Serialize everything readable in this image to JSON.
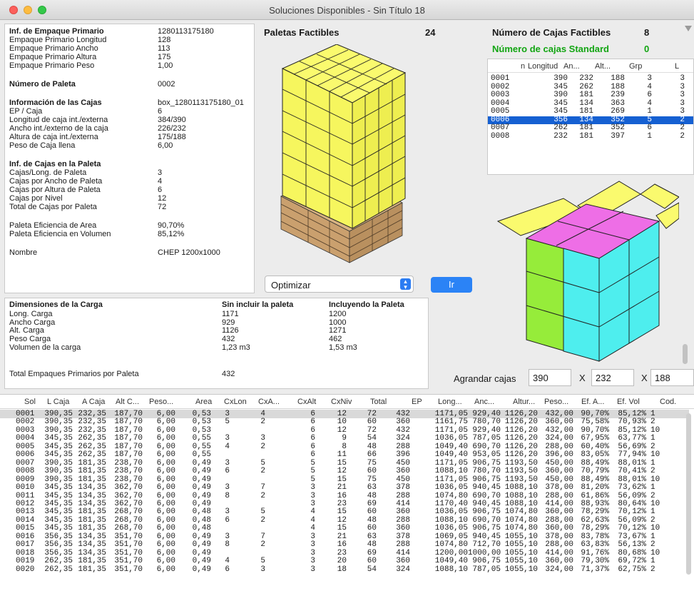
{
  "window": {
    "title": "Soluciones Disponibles - Sin Título 18"
  },
  "primary": {
    "rows": [
      {
        "label": "Inf. de Empaque Primario",
        "value": "1280113175180",
        "bold": true
      },
      {
        "label": "Empaque Primario Longitud",
        "value": "128"
      },
      {
        "label": "Empaque Primario Ancho",
        "value": "113"
      },
      {
        "label": "Empaque Primario Altura",
        "value": "175"
      },
      {
        "label": "Empaque Primario Peso",
        "value": "1,00"
      },
      {
        "label": "Número de Paleta",
        "value": "0002",
        "bold": true
      },
      {
        "label": "Información de las Cajas",
        "value": "box_1280113175180_01",
        "bold": true
      },
      {
        "label": "EP / Caja",
        "value": "6"
      },
      {
        "label": "Longitud de caja int./externa",
        "value": "384/390"
      },
      {
        "label": "Ancho int./externo de la caja",
        "value": "226/232"
      },
      {
        "label": "Altura de caja int./externa",
        "value": "175/188"
      },
      {
        "label": "Peso de Caja llena",
        "value": "6,00"
      },
      {
        "label": "Inf. de Cajas en la Paleta",
        "value": "",
        "bold": true
      },
      {
        "label": "Cajas/Long. de Paleta",
        "value": "3"
      },
      {
        "label": "Cajas por Ancho de Paleta",
        "value": "4"
      },
      {
        "label": "Cajas por Altura de Paleta",
        "value": "6"
      },
      {
        "label": "Cajas por Nivel",
        "value": "12"
      },
      {
        "label": "Total de Cajas por Paleta",
        "value": "72"
      },
      {
        "label": "Paleta Eficiencia de Area",
        "value": "90,70%"
      },
      {
        "label": "Paleta Eficiencia en Volumen",
        "value": "85,12%"
      },
      {
        "label": "Nombre",
        "value": "CHEP 1200x1000"
      }
    ]
  },
  "feasible": {
    "pallets_label": "Paletas Factibles",
    "pallets_count": "24",
    "boxes_label": "Número de Cajas Factibles",
    "boxes_count": "8",
    "standard_label": "Número de cajas Standard",
    "standard_count": "0"
  },
  "mini_table": {
    "headers": [
      "n",
      "Longitud",
      "An...",
      "Alt...",
      "Grp",
      "L"
    ],
    "rows": [
      [
        "0001",
        "390",
        "232",
        "188",
        "3",
        "3"
      ],
      [
        "0002",
        "345",
        "262",
        "188",
        "4",
        "3"
      ],
      [
        "0003",
        "390",
        "181",
        "239",
        "6",
        "3"
      ],
      [
        "0004",
        "345",
        "134",
        "363",
        "4",
        "3"
      ],
      [
        "0005",
        "345",
        "181",
        "269",
        "1",
        "3"
      ],
      [
        "0006",
        "356",
        "134",
        "352",
        "5",
        "2"
      ],
      [
        "0007",
        "262",
        "181",
        "352",
        "6",
        "2"
      ],
      [
        "0008",
        "232",
        "181",
        "397",
        "1",
        "2"
      ]
    ],
    "selected_index": 5
  },
  "controls": {
    "optimize_value": "Optimizar",
    "go_label": "Ir",
    "enlarge_label": "Agrandar cajas",
    "enlarge_x": "390",
    "enlarge_y": "232",
    "enlarge_z": "188",
    "times": "X"
  },
  "load": {
    "header": "Dimensiones de la Carga",
    "col1": "Sin incluir la paleta",
    "col2": "Incluyendo la Paleta",
    "rows": [
      {
        "label": "Long. Carga",
        "v1": "1171",
        "v2": "1200"
      },
      {
        "label": "Ancho Carga",
        "v1": "929",
        "v2": "1000"
      },
      {
        "label": "Alt. Carga",
        "v1": "1126",
        "v2": "1271"
      },
      {
        "label": "Peso Carga",
        "v1": "432",
        "v2": "462"
      },
      {
        "label": "Volumen de la carga",
        "v1": "1,23 m3",
        "v2": "1,53 m3"
      }
    ],
    "total_label": "Total Empaques Primarios por Paleta",
    "total_value": "432"
  },
  "colors": {
    "box_yellow": "#fafa6e",
    "box_cyan": "#4eeeee",
    "box_green": "#96ec3a",
    "box_magenta": "#ee6ee6",
    "pallet": "#d9b382",
    "selection": "#1560d2"
  },
  "solutions": {
    "headers": [
      "Sol",
      "L Caja",
      "A Caja",
      "Alt C...",
      "Peso...",
      "Area",
      "CxLon",
      "CxA...",
      "CxAlt",
      "CxNiv",
      "Total",
      "EP",
      "Long...",
      "Anc...",
      "Altur...",
      "Peso...",
      "Ef. A...",
      "Ef. Vol",
      "Cod."
    ],
    "rows": [
      [
        "0001",
        "390,35",
        "232,35",
        "187,70",
        "6,00",
        "0,53",
        "3",
        "4",
        "6",
        "12",
        "72",
        "432",
        "1171,05",
        "929,40",
        "1126,20",
        "432,00",
        "90,70%",
        "85,12%",
        "1"
      ],
      [
        "0002",
        "390,35",
        "232,35",
        "187,70",
        "6,00",
        "0,53",
        "5",
        "2",
        "6",
        "10",
        "60",
        "360",
        "1161,75",
        "780,70",
        "1126,20",
        "360,00",
        "75,58%",
        "70,93%",
        "2"
      ],
      [
        "0003",
        "390,35",
        "232,35",
        "187,70",
        "6,00",
        "0,53",
        "",
        "",
        "6",
        "12",
        "72",
        "432",
        "1171,05",
        "929,40",
        "1126,20",
        "432,00",
        "90,70%",
        "85,12%",
        "10"
      ],
      [
        "0004",
        "345,35",
        "262,35",
        "187,70",
        "6,00",
        "0,55",
        "3",
        "3",
        "6",
        "9",
        "54",
        "324",
        "1036,05",
        "787,05",
        "1126,20",
        "324,00",
        "67,95%",
        "63,77%",
        "1"
      ],
      [
        "0005",
        "345,35",
        "262,35",
        "187,70",
        "6,00",
        "0,55",
        "4",
        "2",
        "6",
        "8",
        "48",
        "288",
        "1049,40",
        "690,70",
        "1126,20",
        "288,00",
        "60,40%",
        "56,69%",
        "2"
      ],
      [
        "0006",
        "345,35",
        "262,35",
        "187,70",
        "6,00",
        "0,55",
        "",
        "",
        "6",
        "11",
        "66",
        "396",
        "1049,40",
        "953,05",
        "1126,20",
        "396,00",
        "83,05%",
        "77,94%",
        "10"
      ],
      [
        "0007",
        "390,35",
        "181,35",
        "238,70",
        "6,00",
        "0,49",
        "3",
        "5",
        "5",
        "15",
        "75",
        "450",
        "1171,05",
        "906,75",
        "1193,50",
        "450,00",
        "88,49%",
        "88,01%",
        "1"
      ],
      [
        "0008",
        "390,35",
        "181,35",
        "238,70",
        "6,00",
        "0,49",
        "6",
        "2",
        "5",
        "12",
        "60",
        "360",
        "1088,10",
        "780,70",
        "1193,50",
        "360,00",
        "70,79%",
        "70,41%",
        "2"
      ],
      [
        "0009",
        "390,35",
        "181,35",
        "238,70",
        "6,00",
        "0,49",
        "",
        "",
        "5",
        "15",
        "75",
        "450",
        "1171,05",
        "906,75",
        "1193,50",
        "450,00",
        "88,49%",
        "88,01%",
        "10"
      ],
      [
        "0010",
        "345,35",
        "134,35",
        "362,70",
        "6,00",
        "0,49",
        "3",
        "7",
        "3",
        "21",
        "63",
        "378",
        "1036,05",
        "940,45",
        "1088,10",
        "378,00",
        "81,20%",
        "73,62%",
        "1"
      ],
      [
        "0011",
        "345,35",
        "134,35",
        "362,70",
        "6,00",
        "0,49",
        "8",
        "2",
        "3",
        "16",
        "48",
        "288",
        "1074,80",
        "690,70",
        "1088,10",
        "288,00",
        "61,86%",
        "56,09%",
        "2"
      ],
      [
        "0012",
        "345,35",
        "134,35",
        "362,70",
        "6,00",
        "0,49",
        "",
        "",
        "3",
        "23",
        "69",
        "414",
        "1170,40",
        "940,45",
        "1088,10",
        "414,00",
        "88,93%",
        "80,64%",
        "10"
      ],
      [
        "0013",
        "345,35",
        "181,35",
        "268,70",
        "6,00",
        "0,48",
        "3",
        "5",
        "4",
        "15",
        "60",
        "360",
        "1036,05",
        "906,75",
        "1074,80",
        "360,00",
        "78,29%",
        "70,12%",
        "1"
      ],
      [
        "0014",
        "345,35",
        "181,35",
        "268,70",
        "6,00",
        "0,48",
        "6",
        "2",
        "4",
        "12",
        "48",
        "288",
        "1088,10",
        "690,70",
        "1074,80",
        "288,00",
        "62,63%",
        "56,09%",
        "2"
      ],
      [
        "0015",
        "345,35",
        "181,35",
        "268,70",
        "6,00",
        "0,48",
        "",
        "",
        "4",
        "15",
        "60",
        "360",
        "1036,05",
        "906,75",
        "1074,80",
        "360,00",
        "78,29%",
        "70,12%",
        "10"
      ],
      [
        "0016",
        "356,35",
        "134,35",
        "351,70",
        "6,00",
        "0,49",
        "3",
        "7",
        "3",
        "21",
        "63",
        "378",
        "1069,05",
        "940,45",
        "1055,10",
        "378,00",
        "83,78%",
        "73,67%",
        "1"
      ],
      [
        "0017",
        "356,35",
        "134,35",
        "351,70",
        "6,00",
        "0,49",
        "8",
        "2",
        "3",
        "16",
        "48",
        "288",
        "1074,80",
        "712,70",
        "1055,10",
        "288,00",
        "63,83%",
        "56,13%",
        "2"
      ],
      [
        "0018",
        "356,35",
        "134,35",
        "351,70",
        "6,00",
        "0,49",
        "",
        "",
        "3",
        "23",
        "69",
        "414",
        "1200,00",
        "1000,00",
        "1055,10",
        "414,00",
        "91,76%",
        "80,68%",
        "10"
      ],
      [
        "0019",
        "262,35",
        "181,35",
        "351,70",
        "6,00",
        "0,49",
        "4",
        "5",
        "3",
        "20",
        "60",
        "360",
        "1049,40",
        "906,75",
        "1055,10",
        "360,00",
        "79,30%",
        "69,72%",
        "1"
      ],
      [
        "0020",
        "262,35",
        "181,35",
        "351,70",
        "6,00",
        "0,49",
        "6",
        "3",
        "3",
        "18",
        "54",
        "324",
        "1088,10",
        "787,05",
        "1055,10",
        "324,00",
        "71,37%",
        "62,75%",
        "2"
      ]
    ],
    "selected_index": 0
  }
}
